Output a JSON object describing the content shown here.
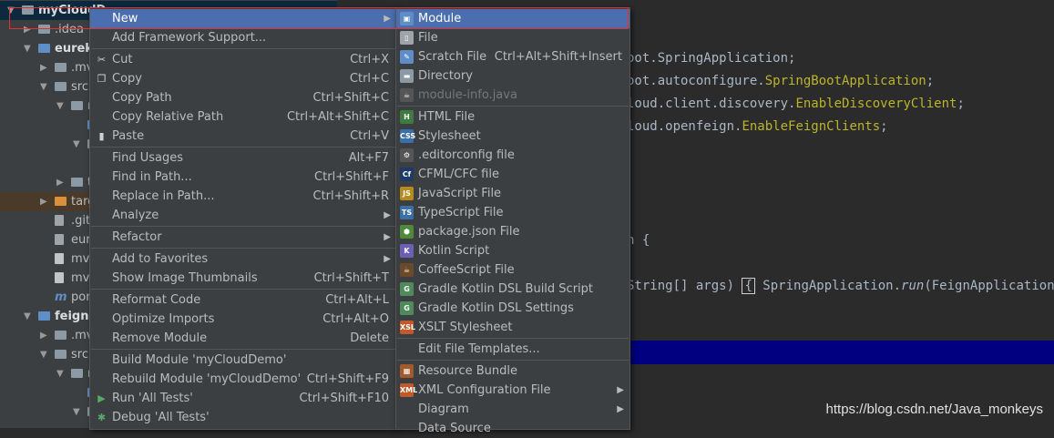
{
  "tree": {
    "rows": [
      {
        "label": "myCloudD",
        "indent": 0,
        "arrow": "▼",
        "icon": "folder",
        "bold": true,
        "selected": true
      },
      {
        "label": ".idea",
        "indent": 1,
        "arrow": "▶",
        "icon": "folder"
      },
      {
        "label": "eureka",
        "indent": 1,
        "arrow": "▼",
        "icon": "blue",
        "bold": true
      },
      {
        "label": ".mvn",
        "indent": 2,
        "arrow": "▶",
        "icon": "folder"
      },
      {
        "label": "src",
        "indent": 2,
        "arrow": "▼",
        "icon": "folder"
      },
      {
        "label": "m",
        "indent": 3,
        "arrow": "▼",
        "icon": "folder"
      },
      {
        "label": "",
        "indent": 4,
        "arrow": "",
        "icon": "blue"
      },
      {
        "label": "",
        "indent": 4,
        "arrow": "▼",
        "icon": "folder"
      },
      {
        "label": "",
        "indent": 0,
        "arrow": "",
        "icon": ""
      },
      {
        "label": "t",
        "indent": 3,
        "arrow": "▶",
        "icon": "folder"
      },
      {
        "label": "targ",
        "indent": 2,
        "arrow": "▶",
        "icon": "orange",
        "excluded": true
      },
      {
        "label": ".giti",
        "indent": 2,
        "arrow": "",
        "icon": "file"
      },
      {
        "label": "eure",
        "indent": 2,
        "arrow": "",
        "icon": "file"
      },
      {
        "label": "mvr",
        "indent": 2,
        "arrow": "",
        "icon": "mvn"
      },
      {
        "label": "mvr",
        "indent": 2,
        "arrow": "",
        "icon": "mvn"
      },
      {
        "label": "pon",
        "indent": 2,
        "arrow": "",
        "icon": "pom"
      },
      {
        "label": "feign",
        "indent": 1,
        "arrow": "▼",
        "icon": "blue",
        "bold": true
      },
      {
        "label": ".mvi",
        "indent": 2,
        "arrow": "▶",
        "icon": "folder"
      },
      {
        "label": "src",
        "indent": 2,
        "arrow": "▼",
        "icon": "folder"
      },
      {
        "label": "r",
        "indent": 3,
        "arrow": "▼",
        "icon": "folder"
      },
      {
        "label": "",
        "indent": 4,
        "arrow": "",
        "icon": "blue"
      },
      {
        "label": "",
        "indent": 4,
        "arrow": "▼",
        "icon": "folder"
      }
    ]
  },
  "editor": {
    "lines": [
      {
        "parts": [
          {
            "t": "oot.SpringApplication;"
          }
        ]
      },
      {
        "parts": [
          {
            "t": "oot.autoconfigure."
          },
          {
            "t": "SpringBootApplication",
            "c": "ann"
          },
          {
            "t": ";"
          }
        ]
      },
      {
        "parts": [
          {
            "t": "loud.client.discovery."
          },
          {
            "t": "EnableDiscoveryClient",
            "c": "ann"
          },
          {
            "t": ";"
          }
        ]
      },
      {
        "parts": [
          {
            "t": "loud.openfeign."
          },
          {
            "t": "EnableFeignClients",
            "c": "ann"
          },
          {
            "t": ";"
          }
        ]
      },
      {
        "parts": [
          {
            "t": "n {"
          }
        ]
      },
      {
        "parts": [
          {
            "t": "String[] args) "
          },
          {
            "t": "{",
            "c": "bracebox"
          },
          {
            "t": " SpringApplication."
          },
          {
            "t": "run",
            "c": "it"
          },
          {
            "t": "(FeignApplication.cla"
          }
        ]
      }
    ],
    "watermark": "https://blog.csdn.net/Java_monkeys"
  },
  "context_menu": {
    "items": [
      {
        "label": "New",
        "submenu": true,
        "active": true
      },
      {
        "label": "Add Framework Support..."
      },
      {
        "sep": true
      },
      {
        "label": "Cut",
        "shortcut": "Ctrl+X",
        "icon": "cut-icon",
        "glyph": "✂"
      },
      {
        "label": "Copy",
        "shortcut": "Ctrl+C",
        "icon": "copy-icon",
        "glyph": "❐"
      },
      {
        "label": "Copy Path",
        "shortcut": "Ctrl+Shift+C"
      },
      {
        "label": "Copy Relative Path",
        "shortcut": "Ctrl+Alt+Shift+C"
      },
      {
        "label": "Paste",
        "shortcut": "Ctrl+V",
        "icon": "paste-icon",
        "glyph": "▮"
      },
      {
        "sep": true
      },
      {
        "label": "Find Usages",
        "shortcut": "Alt+F7"
      },
      {
        "label": "Find in Path...",
        "shortcut": "Ctrl+Shift+F"
      },
      {
        "label": "Replace in Path...",
        "shortcut": "Ctrl+Shift+R"
      },
      {
        "label": "Analyze",
        "submenu": true
      },
      {
        "sep": true
      },
      {
        "label": "Refactor",
        "submenu": true
      },
      {
        "sep": true
      },
      {
        "label": "Add to Favorites",
        "submenu": true
      },
      {
        "label": "Show Image Thumbnails",
        "shortcut": "Ctrl+Shift+T"
      },
      {
        "sep": true
      },
      {
        "label": "Reformat Code",
        "shortcut": "Ctrl+Alt+L"
      },
      {
        "label": "Optimize Imports",
        "shortcut": "Ctrl+Alt+O"
      },
      {
        "label": "Remove Module",
        "shortcut": "Delete"
      },
      {
        "sep": true
      },
      {
        "label": "Build Module 'myCloudDemo'"
      },
      {
        "label": "Rebuild Module 'myCloudDemo'",
        "shortcut": "Ctrl+Shift+F9"
      },
      {
        "label": "Run 'All Tests'",
        "shortcut": "Ctrl+Shift+F10",
        "icon": "run-icon",
        "glyph": "▶",
        "glyph_color": "#59a869"
      },
      {
        "label": "Debug 'All Tests'",
        "icon": "debug-icon",
        "glyph": "✱",
        "glyph_color": "#59a869"
      }
    ]
  },
  "new_submenu": {
    "items": [
      {
        "label": "Module",
        "icon": "module-icon",
        "badge": "▣",
        "color": "#5f8ec7",
        "active": true
      },
      {
        "label": "File",
        "icon": "file-icon",
        "badge": "▯",
        "color": "#9fa4a8"
      },
      {
        "label": "Scratch File",
        "shortcut": "Ctrl+Alt+Shift+Insert",
        "icon": "scratch-file-icon",
        "badge": "✎",
        "color": "#5f8ec7"
      },
      {
        "label": "Directory",
        "icon": "directory-icon",
        "badge": "▬",
        "color": "#8b9aa5"
      },
      {
        "label": "module-info.java",
        "disabled": true,
        "icon": "module-info-icon",
        "badge": "☕",
        "color": "#555555"
      },
      {
        "sep": true
      },
      {
        "label": "HTML File",
        "icon": "html-file-icon",
        "badge": "H",
        "color": "#3f7a3f"
      },
      {
        "label": "Stylesheet",
        "icon": "stylesheet-icon",
        "badge": "CSS",
        "color": "#3a6fa8"
      },
      {
        "label": ".editorconfig file",
        "icon": "editorconfig-icon",
        "badge": "⚙",
        "color": "#555555"
      },
      {
        "label": "CFML/CFC file",
        "icon": "cfml-icon",
        "badge": "Cf",
        "color": "#1e3a66"
      },
      {
        "label": "JavaScript File",
        "icon": "javascript-file-icon",
        "badge": "JS",
        "color": "#b58a1e"
      },
      {
        "label": "TypeScript File",
        "icon": "typescript-file-icon",
        "badge": "TS",
        "color": "#3a6fa8"
      },
      {
        "label": "package.json File",
        "icon": "package-json-icon",
        "badge": "⬢",
        "color": "#4f8a3a"
      },
      {
        "label": "Kotlin Script",
        "icon": "kotlin-script-icon",
        "badge": "K",
        "color": "#6c5fb5"
      },
      {
        "label": "CoffeeScript File",
        "icon": "coffeescript-file-icon",
        "badge": "☕",
        "color": "#6b4a2a"
      },
      {
        "label": "Gradle Kotlin DSL Build Script",
        "icon": "gradle-build-icon",
        "badge": "G",
        "color": "#4f8a5a"
      },
      {
        "label": "Gradle Kotlin DSL Settings",
        "icon": "gradle-settings-icon",
        "badge": "G",
        "color": "#4f8a5a"
      },
      {
        "label": "XSLT Stylesheet",
        "icon": "xslt-icon",
        "badge": "XSL",
        "color": "#c05a2a"
      },
      {
        "sep": true
      },
      {
        "label": "Edit File Templates..."
      },
      {
        "sep": true
      },
      {
        "label": "Resource Bundle",
        "icon": "resource-bundle-icon",
        "badge": "▦",
        "color": "#a35a2a"
      },
      {
        "label": "XML Configuration File",
        "submenu": true,
        "icon": "xml-config-icon",
        "badge": "XML",
        "color": "#c05a2a"
      },
      {
        "label": "Diagram",
        "submenu": true
      },
      {
        "label": "Data Source",
        "partial": true
      }
    ]
  }
}
